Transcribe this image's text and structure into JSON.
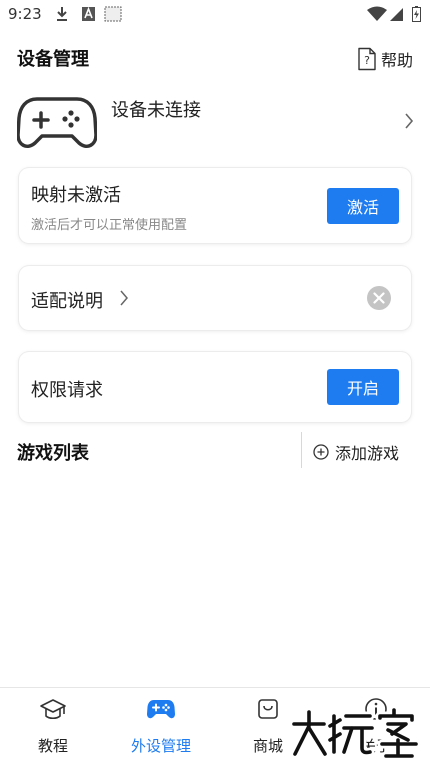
{
  "status_bar": {
    "time": "9:23"
  },
  "header": {
    "title": "设备管理",
    "help_label": "帮助"
  },
  "device": {
    "status": "设备未连接"
  },
  "mapping_card": {
    "title": "映射未激活",
    "subtitle": "激活后才可以正常使用配置",
    "button": "激活"
  },
  "adapt_card": {
    "title": "适配说明"
  },
  "permission_card": {
    "title": "权限请求",
    "button": "开启"
  },
  "games": {
    "title": "游戏列表",
    "add_label": "添加游戏"
  },
  "bottom_nav": {
    "items": [
      {
        "label": "教程",
        "icon": "graduation-cap-icon",
        "active": false
      },
      {
        "label": "外设管理",
        "icon": "gamepad-icon",
        "active": true
      },
      {
        "label": "商城",
        "icon": "shopping-bag-icon",
        "active": false
      },
      {
        "label": "关于",
        "icon": "info-icon",
        "active": false
      }
    ]
  },
  "watermark": {
    "text": "大玩家"
  },
  "colors": {
    "accent": "#1f7cf0",
    "close_icon": "#c4c4c4",
    "muted_text": "#888888"
  }
}
